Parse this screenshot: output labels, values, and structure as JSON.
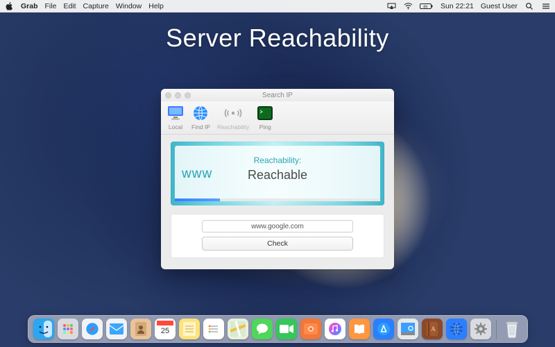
{
  "menubar": {
    "app": "Grab",
    "items": [
      "File",
      "Edit",
      "Capture",
      "Window",
      "Help"
    ],
    "clock": "Sun 22:21",
    "user": "Guest User"
  },
  "hero": {
    "title": "Server Reachability"
  },
  "window": {
    "title": "Search IP",
    "toolbar": {
      "local": "Local",
      "findip": "Find IP",
      "reachability": "Reachability",
      "ping": "Ping"
    },
    "panel": {
      "www": "www",
      "label": "Reachability:",
      "status": "Reachable"
    },
    "form": {
      "url_value": "www.google.com",
      "check_label": "Check"
    }
  },
  "dock": {
    "items": [
      {
        "name": "finder",
        "bg": "#2aa7f0"
      },
      {
        "name": "launchpad",
        "bg": "#d9dbe0"
      },
      {
        "name": "safari",
        "bg": "#f2f2f4"
      },
      {
        "name": "mail",
        "bg": "#f2f2f4"
      },
      {
        "name": "contacts",
        "bg": "#e9c39a"
      },
      {
        "name": "calendar",
        "bg": "#ffffff"
      },
      {
        "name": "notes",
        "bg": "#ffe27a"
      },
      {
        "name": "reminders",
        "bg": "#ffffff"
      },
      {
        "name": "maps",
        "bg": "#e8f1dd"
      },
      {
        "name": "messages",
        "bg": "#4fd65b"
      },
      {
        "name": "facetime",
        "bg": "#35c759"
      },
      {
        "name": "photobooth",
        "bg": "#f07838"
      },
      {
        "name": "itunes",
        "bg": "#ffffff"
      },
      {
        "name": "ibooks",
        "bg": "#ff9640"
      },
      {
        "name": "appstore",
        "bg": "#2a7fff"
      },
      {
        "name": "preview",
        "bg": "#e8e8e8"
      },
      {
        "name": "dictionary",
        "bg": "#8a4a2a"
      },
      {
        "name": "searchip",
        "bg": "#2a7fff"
      },
      {
        "name": "systemprefs",
        "bg": "#d9dbe0"
      }
    ],
    "calendar_day": "25",
    "trash": "trash"
  }
}
